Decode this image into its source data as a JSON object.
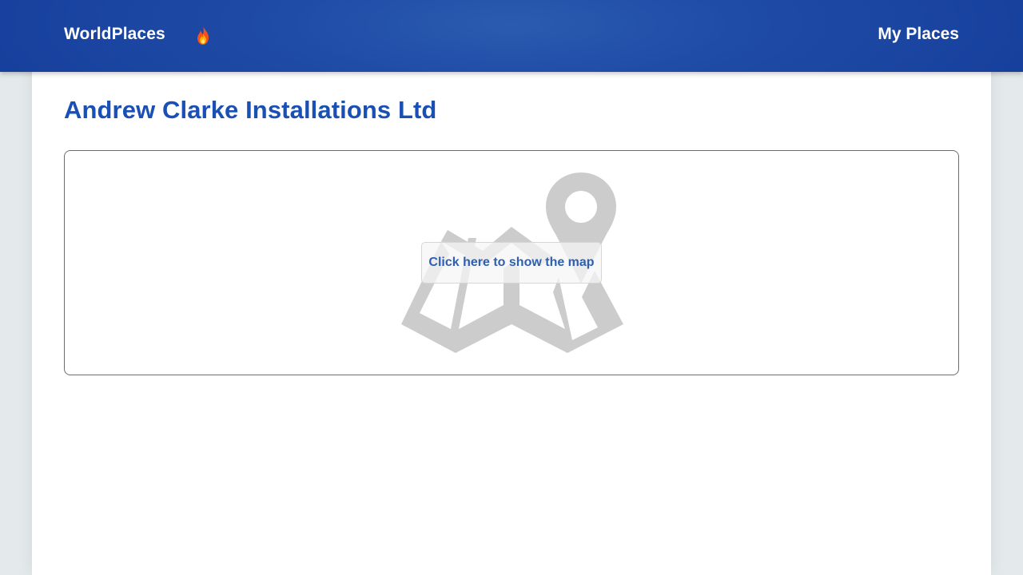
{
  "header": {
    "brand": "WorldPlaces",
    "trending_icon": "fire-icon",
    "nav_link": "My Places"
  },
  "main": {
    "title": "Andrew Clarke Installations Ltd",
    "map_placeholder": {
      "icon": "folded-map-pin-icon",
      "button_label": "Click here to show the map"
    }
  },
  "colors": {
    "header_bg": "#1f4ca7",
    "title": "#1a4fb4",
    "button_text": "#2e5fb0",
    "map_icon": "#cccccc",
    "page_bg": "#e4e9ec"
  }
}
